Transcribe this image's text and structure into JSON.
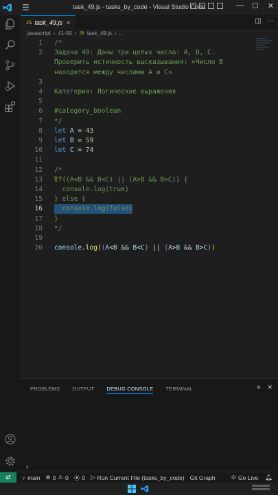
{
  "window": {
    "title": "task_49.js - tasks_by_code - Visual Studio Code",
    "menu_icon": "hamburger-icon"
  },
  "tab": {
    "icon_text": "JS",
    "name": "task_49.js",
    "close": "×"
  },
  "breadcrumb": {
    "folder": "javascript",
    "sub": "41-50",
    "file_icon": "JS",
    "file": "task_49.js",
    "more": "..."
  },
  "editor": {
    "lines": [
      {
        "n": "1",
        "t": [
          {
            "c": "cm",
            "s": "/*"
          }
        ]
      },
      {
        "n": "2",
        "t": [
          {
            "c": "cm",
            "s": "Задача 49: Даны три целых числа: A, B, C."
          }
        ]
      },
      {
        "n": "",
        "t": [
          {
            "c": "cm",
            "s": "Проверить истинность высказывания: «Число B"
          }
        ]
      },
      {
        "n": "",
        "t": [
          {
            "c": "cm",
            "s": "находится между числами A и C»"
          }
        ]
      },
      {
        "n": "3",
        "t": []
      },
      {
        "n": "4",
        "t": [
          {
            "c": "cm",
            "s": "Категория: Логические выражения"
          }
        ]
      },
      {
        "n": "5",
        "t": []
      },
      {
        "n": "6",
        "t": [
          {
            "c": "cm",
            "s": "#category_boolean"
          }
        ]
      },
      {
        "n": "7",
        "t": [
          {
            "c": "cm",
            "s": "*/"
          }
        ]
      },
      {
        "n": "8",
        "t": [
          {
            "c": "kw",
            "s": "let "
          },
          {
            "c": "var",
            "s": "A"
          },
          {
            "c": "pl",
            "s": " = "
          },
          {
            "c": "num",
            "s": "43"
          }
        ]
      },
      {
        "n": "9",
        "t": [
          {
            "c": "kw",
            "s": "let "
          },
          {
            "c": "var",
            "s": "B"
          },
          {
            "c": "pl",
            "s": " = "
          },
          {
            "c": "num",
            "s": "59"
          }
        ]
      },
      {
        "n": "10",
        "t": [
          {
            "c": "kw",
            "s": "let "
          },
          {
            "c": "var",
            "s": "C"
          },
          {
            "c": "pl",
            "s": " = "
          },
          {
            "c": "num",
            "s": "74"
          }
        ]
      },
      {
        "n": "11",
        "t": []
      },
      {
        "n": "12",
        "t": [
          {
            "c": "cm",
            "s": "/*"
          }
        ]
      },
      {
        "n": "13",
        "t": [
          {
            "c": "cm",
            "s": "if((A<B && B<C) || (A>B && B>C)) {"
          }
        ]
      },
      {
        "n": "14",
        "t": [
          {
            "c": "cm",
            "s": "  console.log(true)"
          }
        ]
      },
      {
        "n": "15",
        "t": [
          {
            "c": "cm",
            "s": "} else {"
          }
        ]
      },
      {
        "n": "16",
        "t": [
          {
            "c": "cm",
            "s": "  console.log(false)"
          }
        ],
        "current": true
      },
      {
        "n": "17",
        "t": [
          {
            "c": "cm",
            "s": "}"
          }
        ]
      },
      {
        "n": "18",
        "t": [
          {
            "c": "cm",
            "s": "*/"
          }
        ]
      },
      {
        "n": "19",
        "t": []
      },
      {
        "n": "20",
        "t": [
          {
            "c": "var",
            "s": "console"
          },
          {
            "c": "pl",
            "s": "."
          },
          {
            "c": "fn",
            "s": "log"
          },
          {
            "c": "ye",
            "s": "("
          },
          {
            "c": "pu",
            "s": "("
          },
          {
            "c": "var",
            "s": "A"
          },
          {
            "c": "pl",
            "s": "<"
          },
          {
            "c": "var",
            "s": "B"
          },
          {
            "c": "pl",
            "s": " && "
          },
          {
            "c": "var",
            "s": "B"
          },
          {
            "c": "pl",
            "s": "<"
          },
          {
            "c": "var",
            "s": "C"
          },
          {
            "c": "pu",
            "s": ")"
          },
          {
            "c": "pl",
            "s": " || "
          },
          {
            "c": "pu",
            "s": "("
          },
          {
            "c": "var",
            "s": "A"
          },
          {
            "c": "pl",
            "s": ">"
          },
          {
            "c": "var",
            "s": "B"
          },
          {
            "c": "pl",
            "s": " && "
          },
          {
            "c": "var",
            "s": "B"
          },
          {
            "c": "pl",
            "s": ">"
          },
          {
            "c": "var",
            "s": "C"
          },
          {
            "c": "pu",
            "s": ")"
          },
          {
            "c": "ye",
            "s": ")"
          }
        ]
      }
    ]
  },
  "panel": {
    "tabs": [
      {
        "label": "PROBLEMS",
        "active": false
      },
      {
        "label": "OUTPUT",
        "active": false
      },
      {
        "label": "DEBUG CONSOLE",
        "active": true
      },
      {
        "label": "TERMINAL",
        "active": false
      }
    ],
    "prompt": "›"
  },
  "status": {
    "branch": "main",
    "errors": "0",
    "warnings": "0",
    "ports": "0",
    "run_file": "Run Current File (tasks_by_code)",
    "git_graph": "Git Graph",
    "go_live": "Go Live"
  },
  "colors": {
    "accent": "#0078d4",
    "remote": "#16825d",
    "comment": "#6a9955",
    "keyword": "#569cd6"
  }
}
